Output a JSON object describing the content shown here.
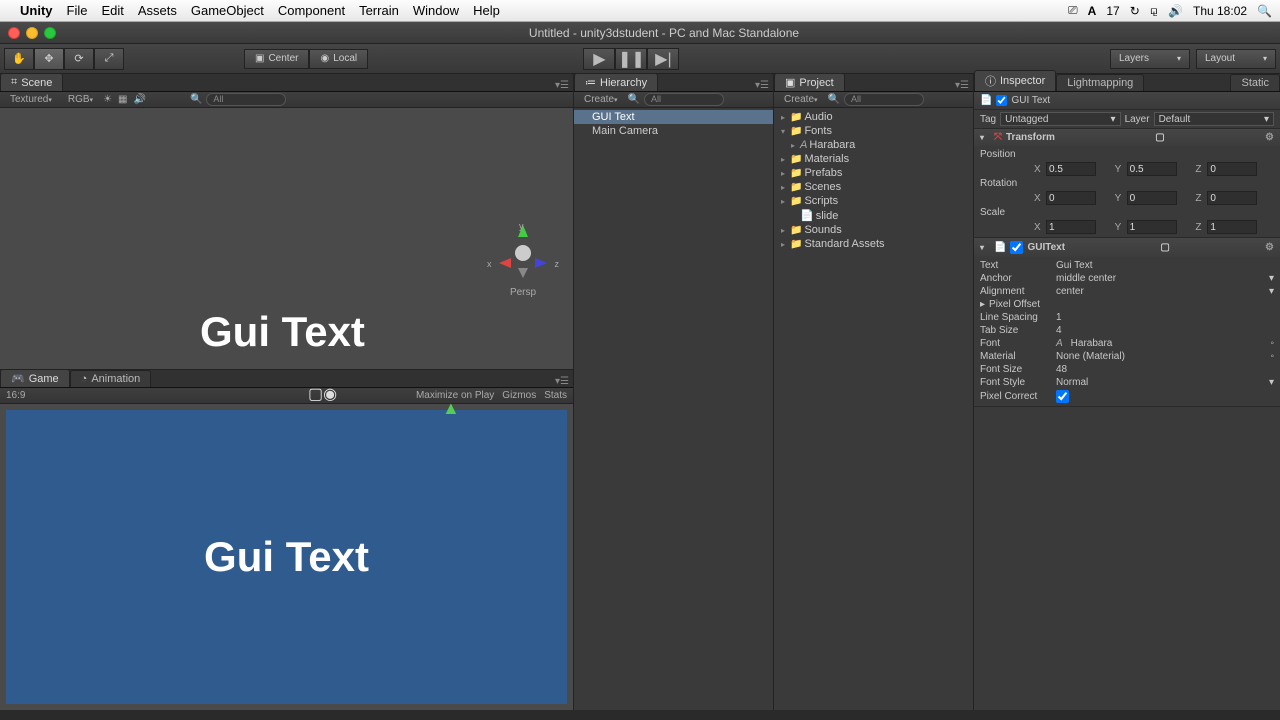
{
  "mac_menu": {
    "app": "Unity",
    "items": [
      "File",
      "Edit",
      "Assets",
      "GameObject",
      "Component",
      "Terrain",
      "Window",
      "Help"
    ],
    "right": {
      "battery": "17",
      "clock": "Thu 18:02"
    }
  },
  "window": {
    "title": "Untitled - unity3dstudent - PC and Mac Standalone"
  },
  "toolbar": {
    "pivot_center": "Center",
    "pivot_local": "Local",
    "layers": "Layers",
    "layout": "Layout"
  },
  "scene": {
    "tab": "Scene",
    "shading": "Textured",
    "rgb": "RGB",
    "search_prefix": "All",
    "gui_text": "Gui Text",
    "view_mode": "Persp",
    "axes": {
      "x": "x",
      "y": "y",
      "z": "z"
    }
  },
  "game": {
    "tab_game": "Game",
    "tab_anim": "Animation",
    "aspect": "16:9",
    "maximize": "Maximize on Play",
    "gizmos": "Gizmos",
    "stats": "Stats",
    "gui_text": "Gui Text"
  },
  "hierarchy": {
    "tab": "Hierarchy",
    "create": "Create",
    "search_prefix": "All",
    "items": [
      "GUI Text",
      "Main Camera"
    ]
  },
  "project": {
    "tab": "Project",
    "create": "Create",
    "search_prefix": "All",
    "folders": [
      "Audio",
      "Fonts",
      "Materials",
      "Prefabs",
      "Scenes",
      "Scripts",
      "Sounds",
      "Standard Assets"
    ],
    "fonts_child": "Harabara",
    "slide": "slide"
  },
  "inspector": {
    "tab_inspector": "Inspector",
    "tab_lightmap": "Lightmapping",
    "static": "Static",
    "obj_name": "GUI Text",
    "tag_label": "Tag",
    "tag_value": "Untagged",
    "layer_label": "Layer",
    "layer_value": "Default",
    "transform": {
      "title": "Transform",
      "pos_label": "Position",
      "rot_label": "Rotation",
      "scale_label": "Scale",
      "pos": {
        "x": "0.5",
        "y": "0.5",
        "z": "0"
      },
      "rot": {
        "x": "0",
        "y": "0",
        "z": "0"
      },
      "scale": {
        "x": "1",
        "y": "1",
        "z": "1"
      }
    },
    "guitext": {
      "title": "GUIText",
      "text_label": "Text",
      "text": "Gui Text",
      "anchor_label": "Anchor",
      "anchor": "middle center",
      "align_label": "Alignment",
      "align": "center",
      "pixel_offset_label": "Pixel Offset",
      "line_spacing_label": "Line Spacing",
      "line_spacing": "1",
      "tab_size_label": "Tab Size",
      "tab_size": "4",
      "font_label": "Font",
      "font": "Harabara",
      "material_label": "Material",
      "material": "None (Material)",
      "font_size_label": "Font Size",
      "font_size": "48",
      "font_style_label": "Font Style",
      "font_style": "Normal",
      "pixel_correct_label": "Pixel Correct",
      "pixel_correct": true
    }
  }
}
